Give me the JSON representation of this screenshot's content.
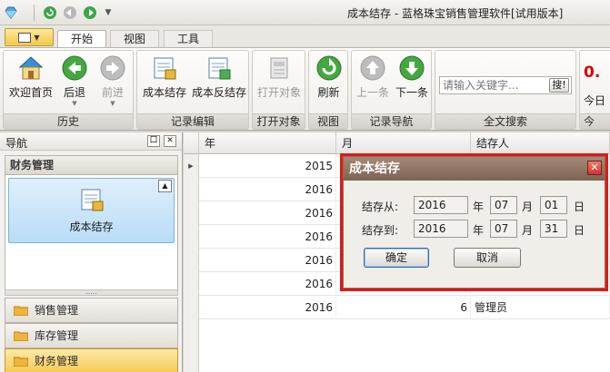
{
  "window": {
    "title": "成本结存 - 蓝格珠宝销售管理软件[试用版本]"
  },
  "tabs": [
    {
      "label": "开始",
      "active": true
    },
    {
      "label": "视图",
      "active": false
    },
    {
      "label": "工具",
      "active": false
    }
  ],
  "ribbon": {
    "home": "欢迎首页",
    "back": "后退",
    "forward": "前进",
    "group_history": "历史",
    "cost_settle": "成本结存",
    "cost_unsettle": "成本反结存",
    "group_record_edit": "记录编辑",
    "open_object": "打开对象",
    "group_open_object": "打开对象",
    "refresh": "刷新",
    "group_view": "视图",
    "prev": "上一条",
    "next": "下一条",
    "group_record_nav": "记录导航",
    "search_placeholder": "请输入关键字...",
    "search_go": "搜!",
    "group_search": "全文搜索",
    "today_value": "0.",
    "today_label": "今日",
    "group_today": "今"
  },
  "nav": {
    "title": "导航",
    "section": "财务管理",
    "selected_item": "成本结存",
    "categories": [
      "销售管理",
      "库存管理",
      "财务管理"
    ]
  },
  "grid": {
    "columns": [
      "年",
      "月",
      "结存人"
    ],
    "rows": [
      {
        "year": "2015",
        "month": "",
        "person": ""
      },
      {
        "year": "2016",
        "month": "",
        "person": ""
      },
      {
        "year": "2016",
        "month": "",
        "person": ""
      },
      {
        "year": "2016",
        "month": "",
        "person": ""
      },
      {
        "year": "2016",
        "month": "",
        "person": ""
      },
      {
        "year": "2016",
        "month": "",
        "person": ""
      },
      {
        "year": "2016",
        "month": "6",
        "person": "管理员"
      }
    ]
  },
  "dialog": {
    "title": "成本结存",
    "from_label": "结存从:",
    "to_label": "结存到:",
    "from": {
      "year": "2016",
      "month": "07",
      "day": "01"
    },
    "to": {
      "year": "2016",
      "month": "07",
      "day": "31"
    },
    "year_unit": "年",
    "month_unit": "月",
    "day_unit": "日",
    "ok": "确定",
    "cancel": "取消"
  },
  "colors": {
    "highlight": "#e01818",
    "today_value": "#d40000"
  }
}
